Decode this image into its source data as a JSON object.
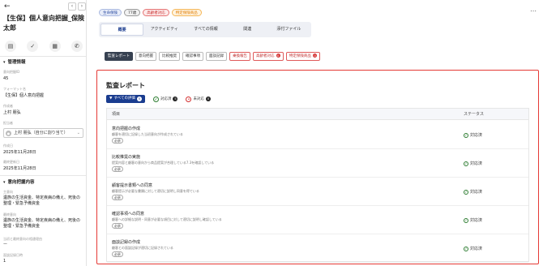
{
  "sidebar": {
    "title": "【生保】個人意向把握_保険 太郎",
    "mgmt_section": "管理情報",
    "intent_no_label": "意向把握ID",
    "intent_no": "45",
    "format_label": "フォーマット名",
    "format_name": "【生保】個人意向把握",
    "author_label": "作成者",
    "author": "上村 朋弘",
    "assignee_label": "担当者",
    "assignee": "上村 朋弘（自分に割り当て）",
    "created_label": "作成日",
    "created": "2025年11月28日",
    "updated_label": "最終更新日",
    "updated": "2025年11月28日",
    "intent_section": "意向把握内容",
    "main_intent_label": "主意向",
    "main_intent": "遺族の生活資金、特定疾病の備え、死後の整理・緊急予備資金",
    "final_intent_label": "最終意向",
    "final_intent": "遺族の生活資金、特定疾病の備え、死後の整理・緊急予備資金",
    "diff_label": "当初と最終意向の相違理由",
    "diff": "ー",
    "record_label": "面談記録日時",
    "record": "1"
  },
  "badges": [
    {
      "label": "生命保険",
      "bg": "#e8edf9",
      "fg": "#2a4aa0",
      "bd": "#a9b8e0"
    },
    {
      "label": "77歳",
      "bg": "#f2f2f2",
      "fg": "#333333",
      "bd": "#999999"
    },
    {
      "label": "高齢者対応",
      "bg": "#fdeaea",
      "fg": "#c62828",
      "bd": "#e57373"
    },
    {
      "label": "特定保険商品",
      "bg": "#fff4e0",
      "fg": "#e07b00",
      "bd": "#f5b657"
    }
  ],
  "tabs": [
    "概要",
    "アクティビティ",
    "すべての情報",
    "関連",
    "添付ファイル"
  ],
  "chips": [
    {
      "label": "監査レポート",
      "type": "sel",
      "count": ""
    },
    {
      "label": "意向把握",
      "type": "",
      "count": ""
    },
    {
      "label": "比較推奨",
      "type": "",
      "count": ""
    },
    {
      "label": "確認事項",
      "type": "",
      "count": ""
    },
    {
      "label": "面談記録",
      "type": "",
      "count": ""
    },
    {
      "label": "乗換報告",
      "type": "red",
      "count": ""
    },
    {
      "label": "高齢者対応",
      "type": "red",
      "count": "0"
    },
    {
      "label": "特定保険商品",
      "type": "red",
      "count": "0"
    }
  ],
  "report": {
    "title": "監査レポート",
    "filter_all": "すべての評価",
    "filter_all_count": "5",
    "filter_done": "対応済",
    "filter_done_count": "5",
    "filter_todo": "未対応",
    "filter_todo_count": "0",
    "col_item": "項目",
    "col_status": "ステータス",
    "rows": [
      {
        "title": "意向把握の作成",
        "desc": "顧客を適切に記録した当初意向が作成されている",
        "req": "必須",
        "status": "対応済"
      },
      {
        "title": "比較推奨の実施",
        "desc": "提案内容と顧客の意向から商品提案が合理している7.3を確認している",
        "req": "必須",
        "status": "対応済"
      },
      {
        "title": "顧客提示書類への同意",
        "desc": "顧客提示が必要な書類に対して適切に説明し同意を得ている",
        "req": "必須",
        "status": "対応済"
      },
      {
        "title": "確認事項への同意",
        "desc": "顧客への詳細な説明・同意が必要な項目に対して適切に説明し確認している",
        "req": "必須",
        "status": "対応済"
      },
      {
        "title": "面談記録の作成",
        "desc": "顧客との面談記録が適切に記録されている",
        "req": "必須",
        "status": "対応済"
      }
    ]
  },
  "colors": {
    "accent": "#1a3c8f",
    "highlight_border": "#e53935",
    "ok": "#2e7d32"
  }
}
